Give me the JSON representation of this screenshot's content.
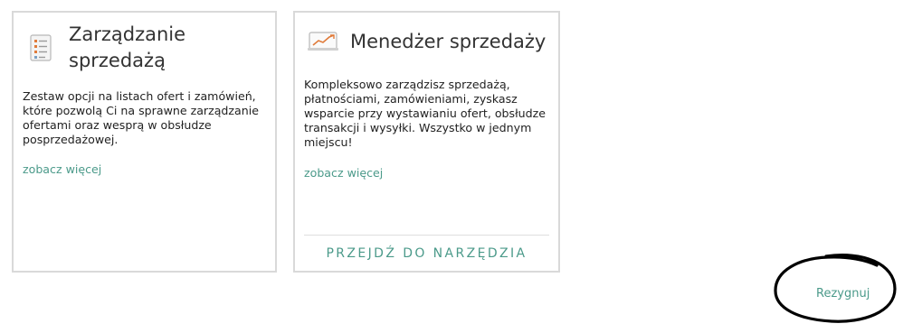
{
  "cards": [
    {
      "icon": "checklist-icon",
      "title": "Zarządzanie sprzedażą",
      "description": "Zestaw opcji na listach ofert i zamówień, które pozwolą Ci na sprawne zarządzanie ofertami oraz wesprą w obsłudze posprzedażowej.",
      "more_link": "zobacz więcej"
    },
    {
      "icon": "sales-chart-icon",
      "title": "Menedżer sprzedaży",
      "description": "Kompleksowo zarządzisz sprzedażą, płatnościami, zamówieniami, zyskasz wsparcie przy wystawianiu ofert, obsłudze transakcji i wysyłki. Wszystko w jednym miejscu!",
      "more_link": "zobacz więcej",
      "action": "PRZEJDŹ DO NARZĘDZIA"
    }
  ],
  "cancel_label": "Rezygnuj",
  "colors": {
    "accent": "#4b9a8a",
    "border": "#d9d9d9",
    "annotation": "#000000"
  }
}
